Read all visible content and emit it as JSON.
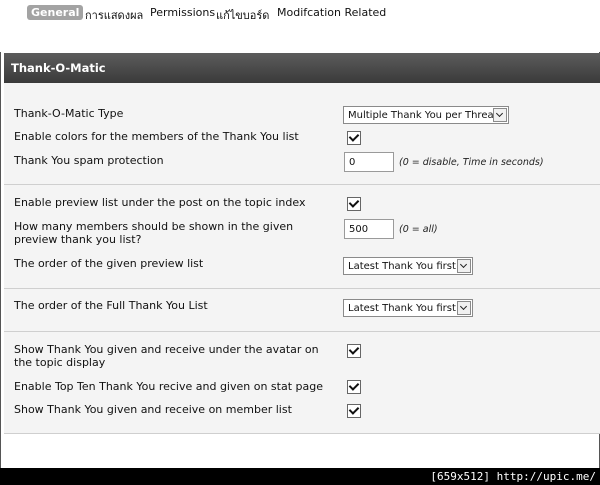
{
  "tabs": [
    {
      "label": "General",
      "active": true
    },
    {
      "label": "การแสดงผล"
    },
    {
      "label": "Permissions"
    },
    {
      "label": "แก้ไขบอร์ด"
    },
    {
      "label": "Modifcation Related"
    }
  ],
  "panel": {
    "title": "Thank-O-Matic",
    "settings": {
      "type": {
        "label": "Thank-O-Matic Type",
        "value": "Multiple Thank You per Thread"
      },
      "colors": {
        "label": "Enable colors for the members of the Thank You list",
        "checked": true
      },
      "spam": {
        "label": "Thank You spam protection",
        "value": "0",
        "hint": "(0 = disable, Time in seconds)"
      },
      "preview_enable": {
        "label": "Enable preview list under the post on the topic index",
        "checked": true
      },
      "preview_count": {
        "label": "How many members should be shown in the given preview thank you list?",
        "value": "500",
        "hint": "(0 = all)"
      },
      "preview_order": {
        "label": "The order of the given preview list",
        "value": "Latest Thank You first"
      },
      "full_order": {
        "label": "The order of the Full Thank You List",
        "value": "Latest Thank You first"
      },
      "avatar": {
        "label": "Show Thank You given and receive under the avatar on the topic display",
        "checked": true
      },
      "topten": {
        "label": "Enable Top Ten Thank You recive and given on stat page",
        "checked": true
      },
      "memberlist": {
        "label": "Show Thank You given and receive on member list",
        "checked": true
      }
    }
  },
  "footer": {
    "text": "[659x512] http://upic.me/"
  }
}
